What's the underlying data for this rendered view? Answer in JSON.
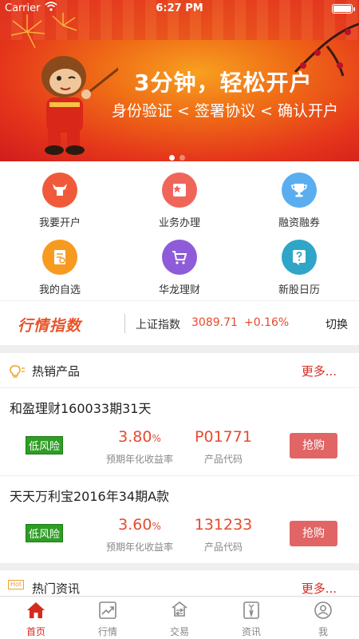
{
  "status": {
    "carrier": "Carrier",
    "time": "6:27 PM"
  },
  "banner": {
    "headline": "3分钟，轻松开户",
    "subline": "身份验证 < 签署协议 < 确认开户"
  },
  "menu": [
    {
      "label": "我要开户",
      "icon": "bull-icon",
      "color": "#f05a3a"
    },
    {
      "label": "业务办理",
      "icon": "business-icon",
      "color": "#f0655a"
    },
    {
      "label": "融资融券",
      "icon": "trophy-icon",
      "color": "#5aaef0"
    },
    {
      "label": "我的自选",
      "icon": "watchlist-icon",
      "color": "#f79a20"
    },
    {
      "label": "华龙理财",
      "icon": "cart-icon",
      "color": "#8e5cd8"
    },
    {
      "label": "新股日历",
      "icon": "question-icon",
      "color": "#2fa6c8"
    }
  ],
  "ticker": {
    "logo": "行情指数",
    "index_name": "上证指数",
    "value": "3089.71",
    "change": "+0.16%",
    "switch": "切换"
  },
  "hot_products": {
    "title": "热销产品",
    "more": "更多..."
  },
  "products": [
    {
      "name": "和盈理财160033期31天",
      "risk": "低风险",
      "rate": "3.80",
      "rate_unit": "%",
      "rate_label": "预期年化收益率",
      "code": "P01771",
      "code_label": "产品代码",
      "buy": "抢购"
    },
    {
      "name": "天天万利宝2016年34期A款",
      "risk": "低风险",
      "rate": "3.60",
      "rate_unit": "%",
      "rate_label": "预期年化收益率",
      "code": "131233",
      "code_label": "产品代码",
      "buy": "抢购"
    }
  ],
  "hot_news": {
    "title": "热门资讯",
    "badge": "Hot",
    "more": "更多..."
  },
  "tabs": [
    {
      "label": "首页",
      "icon": "home-icon",
      "active": true
    },
    {
      "label": "行情",
      "icon": "chart-icon",
      "active": false
    },
    {
      "label": "交易",
      "icon": "trade-icon",
      "active": false
    },
    {
      "label": "资讯",
      "icon": "news-icon",
      "active": false
    },
    {
      "label": "我",
      "icon": "profile-icon",
      "active": false
    }
  ],
  "colors": {
    "accent": "#d42b1f",
    "price": "#e64a2e",
    "risk": "#2e9e24",
    "buy": "#e16565"
  }
}
